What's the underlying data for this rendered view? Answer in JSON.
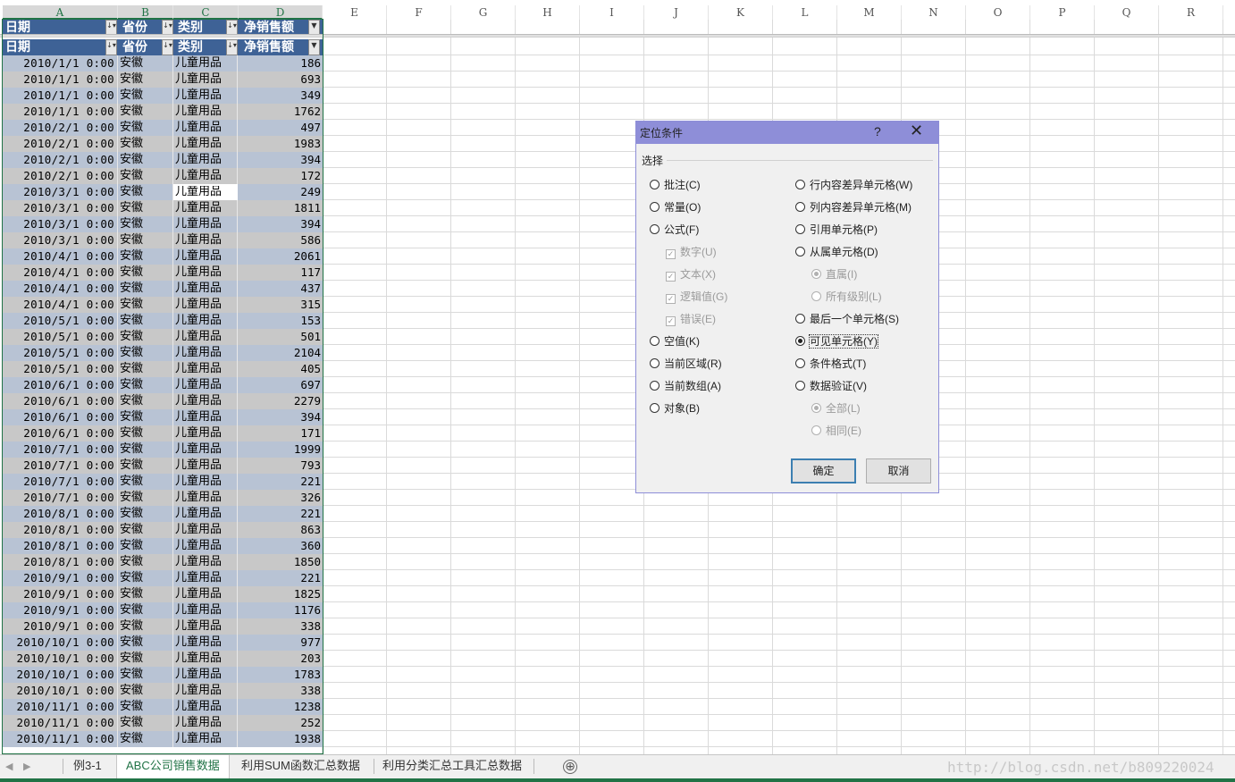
{
  "columns": [
    "A",
    "B",
    "C",
    "D",
    "E",
    "F",
    "G",
    "H",
    "I",
    "J",
    "K",
    "L",
    "M",
    "N",
    "O",
    "P",
    "Q",
    "R"
  ],
  "table_headers": [
    "日期",
    "省份",
    "类别",
    "净销售额"
  ],
  "rows": [
    [
      "2010/1/1  0:00",
      "安徽",
      "儿童用品",
      "186"
    ],
    [
      "2010/1/1  0:00",
      "安徽",
      "儿童用品",
      "693"
    ],
    [
      "2010/1/1  0:00",
      "安徽",
      "儿童用品",
      "349"
    ],
    [
      "2010/1/1  0:00",
      "安徽",
      "儿童用品",
      "1762"
    ],
    [
      "2010/2/1  0:00",
      "安徽",
      "儿童用品",
      "497"
    ],
    [
      "2010/2/1  0:00",
      "安徽",
      "儿童用品",
      "1983"
    ],
    [
      "2010/2/1  0:00",
      "安徽",
      "儿童用品",
      "394"
    ],
    [
      "2010/2/1  0:00",
      "安徽",
      "儿童用品",
      "172"
    ],
    [
      "2010/3/1  0:00",
      "安徽",
      "儿童用品",
      "249"
    ],
    [
      "2010/3/1  0:00",
      "安徽",
      "儿童用品",
      "1811"
    ],
    [
      "2010/3/1  0:00",
      "安徽",
      "儿童用品",
      "394"
    ],
    [
      "2010/3/1  0:00",
      "安徽",
      "儿童用品",
      "586"
    ],
    [
      "2010/4/1  0:00",
      "安徽",
      "儿童用品",
      "2061"
    ],
    [
      "2010/4/1  0:00",
      "安徽",
      "儿童用品",
      "117"
    ],
    [
      "2010/4/1  0:00",
      "安徽",
      "儿童用品",
      "437"
    ],
    [
      "2010/4/1  0:00",
      "安徽",
      "儿童用品",
      "315"
    ],
    [
      "2010/5/1  0:00",
      "安徽",
      "儿童用品",
      "153"
    ],
    [
      "2010/5/1  0:00",
      "安徽",
      "儿童用品",
      "501"
    ],
    [
      "2010/5/1  0:00",
      "安徽",
      "儿童用品",
      "2104"
    ],
    [
      "2010/5/1  0:00",
      "安徽",
      "儿童用品",
      "405"
    ],
    [
      "2010/6/1  0:00",
      "安徽",
      "儿童用品",
      "697"
    ],
    [
      "2010/6/1  0:00",
      "安徽",
      "儿童用品",
      "2279"
    ],
    [
      "2010/6/1  0:00",
      "安徽",
      "儿童用品",
      "394"
    ],
    [
      "2010/6/1  0:00",
      "安徽",
      "儿童用品",
      "171"
    ],
    [
      "2010/7/1  0:00",
      "安徽",
      "儿童用品",
      "1999"
    ],
    [
      "2010/7/1  0:00",
      "安徽",
      "儿童用品",
      "793"
    ],
    [
      "2010/7/1  0:00",
      "安徽",
      "儿童用品",
      "221"
    ],
    [
      "2010/7/1  0:00",
      "安徽",
      "儿童用品",
      "326"
    ],
    [
      "2010/8/1  0:00",
      "安徽",
      "儿童用品",
      "221"
    ],
    [
      "2010/8/1  0:00",
      "安徽",
      "儿童用品",
      "863"
    ],
    [
      "2010/8/1  0:00",
      "安徽",
      "儿童用品",
      "360"
    ],
    [
      "2010/8/1  0:00",
      "安徽",
      "儿童用品",
      "1850"
    ],
    [
      "2010/9/1  0:00",
      "安徽",
      "儿童用品",
      "221"
    ],
    [
      "2010/9/1  0:00",
      "安徽",
      "儿童用品",
      "1825"
    ],
    [
      "2010/9/1  0:00",
      "安徽",
      "儿童用品",
      "1176"
    ],
    [
      "2010/9/1  0:00",
      "安徽",
      "儿童用品",
      "338"
    ],
    [
      "2010/10/1  0:00",
      "安徽",
      "儿童用品",
      "977"
    ],
    [
      "2010/10/1  0:00",
      "安徽",
      "儿童用品",
      "203"
    ],
    [
      "2010/10/1  0:00",
      "安徽",
      "儿童用品",
      "1783"
    ],
    [
      "2010/10/1  0:00",
      "安徽",
      "儿童用品",
      "338"
    ],
    [
      "2010/11/1  0:00",
      "安徽",
      "儿童用品",
      "1238"
    ],
    [
      "2010/11/1  0:00",
      "安徽",
      "儿童用品",
      "252"
    ],
    [
      "2010/11/1  0:00",
      "安徽",
      "儿童用品",
      "1938"
    ]
  ],
  "dialog": {
    "title": "定位条件",
    "help": "?",
    "close": "✕",
    "section": "选择",
    "left_options": [
      "批注(C)",
      "常量(O)",
      "公式(F)"
    ],
    "formula_sub": [
      "数字(U)",
      "文本(X)",
      "逻辑值(G)",
      "错误(E)"
    ],
    "left_options2": [
      "空值(K)",
      "当前区域(R)",
      "当前数组(A)",
      "对象(B)"
    ],
    "right_options": [
      "行内容差异单元格(W)",
      "列内容差异单元格(M)",
      "引用单元格(P)",
      "从属单元格(D)"
    ],
    "dependents_sub": [
      "直属(I)",
      "所有级别(L)"
    ],
    "right_options2": [
      "最后一个单元格(S)",
      "可见单元格(Y)",
      "条件格式(T)",
      "数据验证(V)"
    ],
    "validation_sub": [
      "全部(L)",
      "相同(E)"
    ],
    "selected": "可见单元格(Y)",
    "ok": "确定",
    "cancel": "取消"
  },
  "sheet_tabs": [
    "例3-1",
    "ABC公司销售数据",
    "利用SUM函数汇总数据",
    "利用分类汇总工具汇总数据"
  ],
  "active_tab": "ABC公司销售数据",
  "add_sheet": "⊕",
  "watermark": "http://blog.csdn.net/b809220024",
  "colors": {
    "header": "#3e6296",
    "accent": "#217346",
    "dialog_title": "#8e8ed8"
  }
}
